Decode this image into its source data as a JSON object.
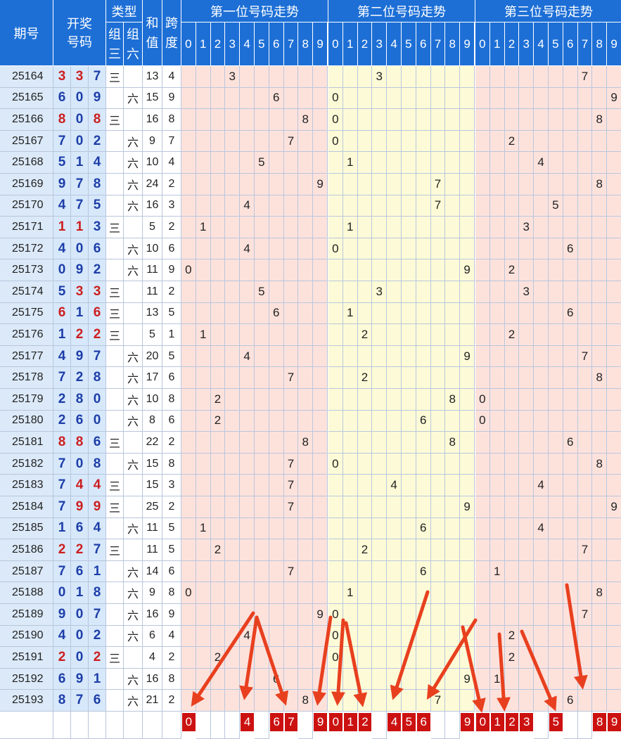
{
  "header": {
    "issue": "期号",
    "draw": "开奖号码",
    "type": "类型",
    "type_g3": "组三",
    "type_g6": "组六",
    "sum": "和值",
    "span": "跨度",
    "pos1": "第一位号码走势",
    "pos2": "第二位号码走势",
    "pos3": "第三位号码走势",
    "digits": [
      "0",
      "1",
      "2",
      "3",
      "4",
      "5",
      "6",
      "7",
      "8",
      "9"
    ]
  },
  "type_labels": {
    "g3": "三",
    "g6": "六"
  },
  "accent_colors": {
    "header_bg": "#1d6fd6",
    "repeat_digit": "#cc1f1f",
    "digit": "#1d3ea8",
    "selected_bg": "#cc1111",
    "arrow": "#e8401f"
  },
  "chart_data": {
    "type": "table",
    "rows": [
      {
        "issue": "25164",
        "digits": [
          3,
          3,
          7
        ],
        "type": "g3",
        "sum": 13,
        "span": 4
      },
      {
        "issue": "25165",
        "digits": [
          6,
          0,
          9
        ],
        "type": "g6",
        "sum": 15,
        "span": 9
      },
      {
        "issue": "25166",
        "digits": [
          8,
          0,
          8
        ],
        "type": "g3",
        "sum": 16,
        "span": 8
      },
      {
        "issue": "25167",
        "digits": [
          7,
          0,
          2
        ],
        "type": "g6",
        "sum": 9,
        "span": 7
      },
      {
        "issue": "25168",
        "digits": [
          5,
          1,
          4
        ],
        "type": "g6",
        "sum": 10,
        "span": 4
      },
      {
        "issue": "25169",
        "digits": [
          9,
          7,
          8
        ],
        "type": "g6",
        "sum": 24,
        "span": 2
      },
      {
        "issue": "25170",
        "digits": [
          4,
          7,
          5
        ],
        "type": "g6",
        "sum": 16,
        "span": 3
      },
      {
        "issue": "25171",
        "digits": [
          1,
          1,
          3
        ],
        "type": "g3",
        "sum": 5,
        "span": 2
      },
      {
        "issue": "25172",
        "digits": [
          4,
          0,
          6
        ],
        "type": "g6",
        "sum": 10,
        "span": 6
      },
      {
        "issue": "25173",
        "digits": [
          0,
          9,
          2
        ],
        "type": "g6",
        "sum": 11,
        "span": 9
      },
      {
        "issue": "25174",
        "digits": [
          5,
          3,
          3
        ],
        "type": "g3",
        "sum": 11,
        "span": 2
      },
      {
        "issue": "25175",
        "digits": [
          6,
          1,
          6
        ],
        "type": "g3",
        "sum": 13,
        "span": 5
      },
      {
        "issue": "25176",
        "digits": [
          1,
          2,
          2
        ],
        "type": "g3",
        "sum": 5,
        "span": 1
      },
      {
        "issue": "25177",
        "digits": [
          4,
          9,
          7
        ],
        "type": "g6",
        "sum": 20,
        "span": 5
      },
      {
        "issue": "25178",
        "digits": [
          7,
          2,
          8
        ],
        "type": "g6",
        "sum": 17,
        "span": 6
      },
      {
        "issue": "25179",
        "digits": [
          2,
          8,
          0
        ],
        "type": "g6",
        "sum": 10,
        "span": 8
      },
      {
        "issue": "25180",
        "digits": [
          2,
          6,
          0
        ],
        "type": "g6",
        "sum": 8,
        "span": 6
      },
      {
        "issue": "25181",
        "digits": [
          8,
          8,
          6
        ],
        "type": "g3",
        "sum": 22,
        "span": 2
      },
      {
        "issue": "25182",
        "digits": [
          7,
          0,
          8
        ],
        "type": "g6",
        "sum": 15,
        "span": 8
      },
      {
        "issue": "25183",
        "digits": [
          7,
          4,
          4
        ],
        "type": "g3",
        "sum": 15,
        "span": 3
      },
      {
        "issue": "25184",
        "digits": [
          7,
          9,
          9
        ],
        "type": "g3",
        "sum": 25,
        "span": 2
      },
      {
        "issue": "25185",
        "digits": [
          1,
          6,
          4
        ],
        "type": "g6",
        "sum": 11,
        "span": 5
      },
      {
        "issue": "25186",
        "digits": [
          2,
          2,
          7
        ],
        "type": "g3",
        "sum": 11,
        "span": 5
      },
      {
        "issue": "25187",
        "digits": [
          7,
          6,
          1
        ],
        "type": "g6",
        "sum": 14,
        "span": 6
      },
      {
        "issue": "25188",
        "digits": [
          0,
          1,
          8
        ],
        "type": "g6",
        "sum": 9,
        "span": 8
      },
      {
        "issue": "25189",
        "digits": [
          9,
          0,
          7
        ],
        "type": "g6",
        "sum": 16,
        "span": 9
      },
      {
        "issue": "25190",
        "digits": [
          4,
          0,
          2
        ],
        "type": "g6",
        "sum": 6,
        "span": 4
      },
      {
        "issue": "25191",
        "digits": [
          2,
          0,
          2
        ],
        "type": "g3",
        "sum": 4,
        "span": 2
      },
      {
        "issue": "25192",
        "digits": [
          6,
          9,
          1
        ],
        "type": "g6",
        "sum": 16,
        "span": 8
      },
      {
        "issue": "25193",
        "digits": [
          8,
          7,
          6
        ],
        "type": "g6",
        "sum": 21,
        "span": 2
      }
    ],
    "selected": {
      "pos1": [
        0,
        4,
        6,
        7,
        9
      ],
      "pos2": [
        0,
        1,
        2,
        4,
        5,
        6,
        9
      ],
      "pos3": [
        0,
        1,
        2,
        3,
        5,
        8,
        9
      ]
    }
  }
}
